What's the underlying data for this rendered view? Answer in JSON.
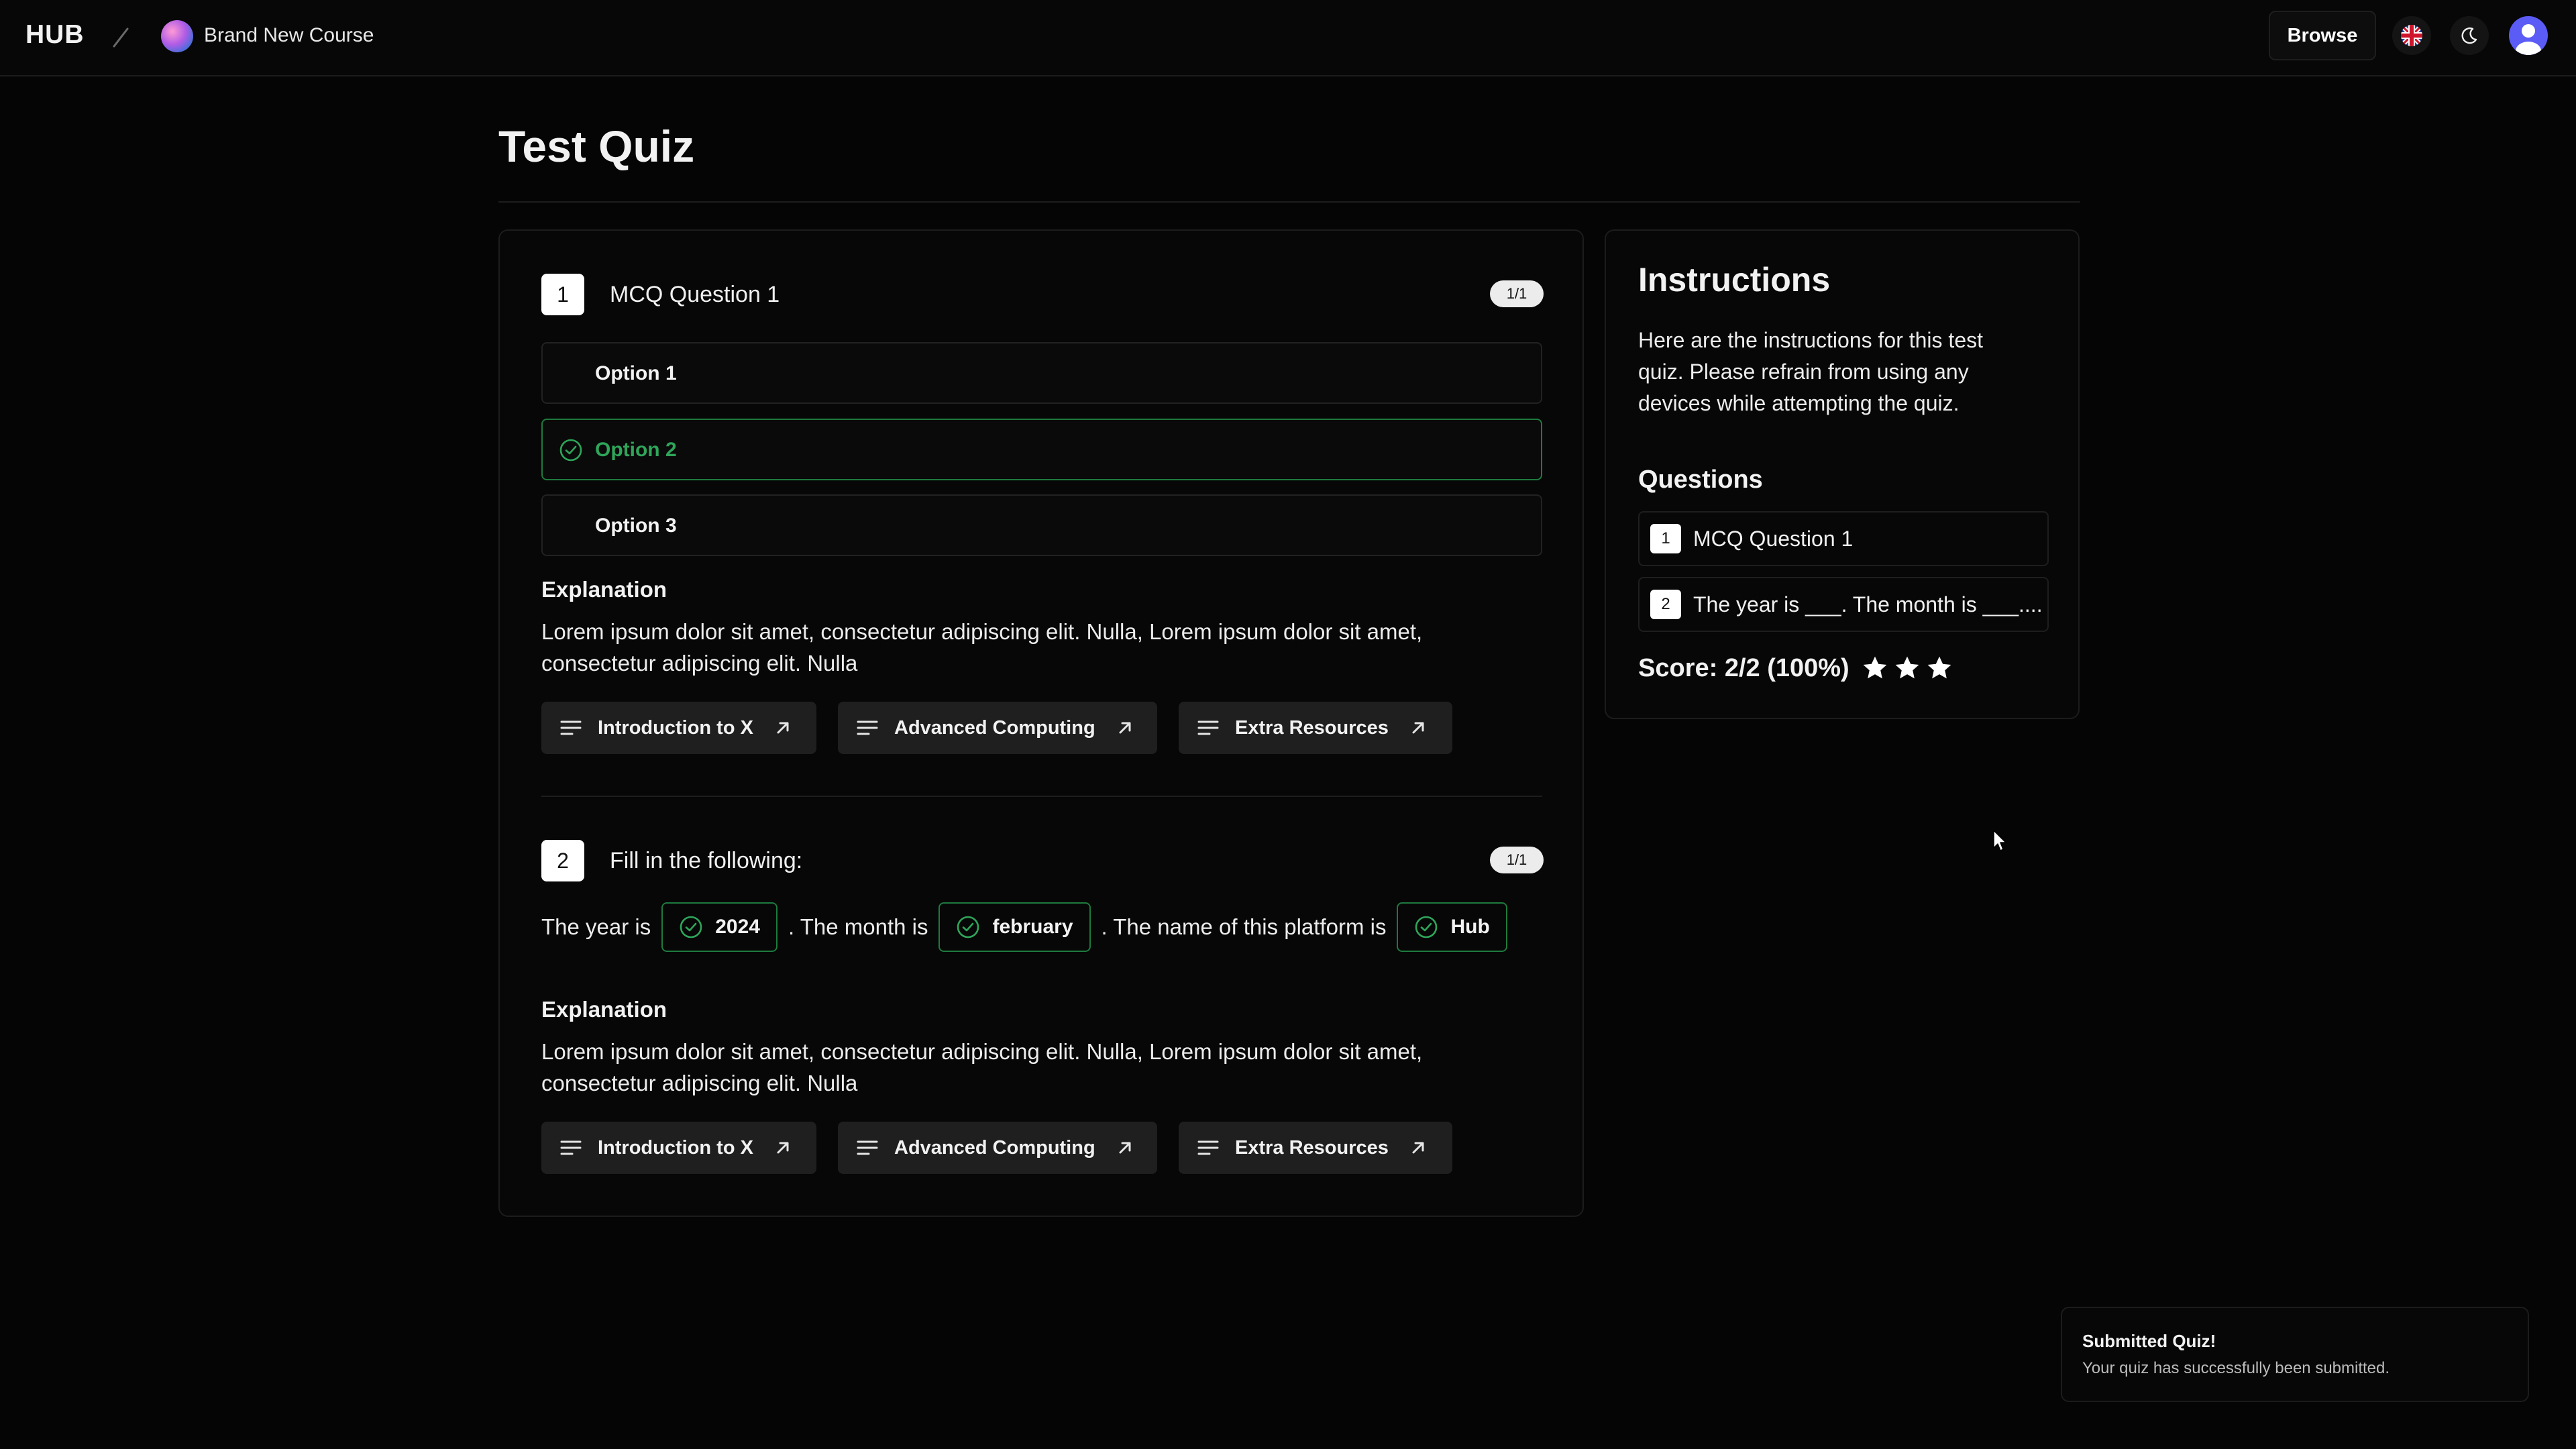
{
  "header": {
    "logo": "HUB",
    "course_name": "Brand New Course",
    "browse_label": "Browse"
  },
  "page": {
    "title": "Test Quiz"
  },
  "quiz": {
    "q1": {
      "number": "1",
      "title": "MCQ Question 1",
      "score": "1/1",
      "options": [
        "Option 1",
        "Option 2",
        "Option 3"
      ],
      "correct_option_index": 1,
      "explanation_heading": "Explanation",
      "explanation_line1": "Lorem ipsum dolor sit amet, consectetur adipiscing elit. Nulla, Lorem ipsum dolor sit amet,",
      "explanation_line2": "consectetur adipiscing elit. Nulla",
      "resources": [
        "Introduction to X",
        "Advanced Computing",
        "Extra Resources"
      ]
    },
    "q2": {
      "number": "2",
      "title": "Fill in the following:",
      "score": "1/1",
      "text_a": "The year is",
      "blank_a": "2024",
      "text_b": ". The month is",
      "blank_b": "february",
      "text_c": ". The name of this platform is",
      "blank_c": "Hub",
      "explanation_heading": "Explanation",
      "explanation_line1": "Lorem ipsum dolor sit amet, consectetur adipiscing elit. Nulla, Lorem ipsum dolor sit amet,",
      "explanation_line2": "consectetur adipiscing elit. Nulla",
      "resources": [
        "Introduction to X",
        "Advanced Computing",
        "Extra Resources"
      ]
    }
  },
  "instructions": {
    "title": "Instructions",
    "line1": "Here are the instructions for this test",
    "line2": "quiz. Please refrain from using any",
    "line3": "devices while attempting the quiz.",
    "questions_heading": "Questions",
    "questions": [
      {
        "number": "1",
        "label": "MCQ Question 1"
      },
      {
        "number": "2",
        "label": "The year is ___. The month is ___...."
      }
    ],
    "score_text": "Score: 2/2 (100%)",
    "stars": 3
  },
  "toast": {
    "title": "Submitted Quiz!",
    "body": "Your quiz has successfully been submitted."
  },
  "colors": {
    "background": "#050505",
    "correct_green": "#2fa55a",
    "avatar_blue": "#5b5cf6"
  },
  "icons": [
    "slash-icon",
    "flag-uk-icon",
    "moon-icon",
    "user-avatar-icon",
    "check-circle-icon",
    "lines-icon",
    "arrow-up-right-icon",
    "star-icon",
    "cursor-icon"
  ]
}
